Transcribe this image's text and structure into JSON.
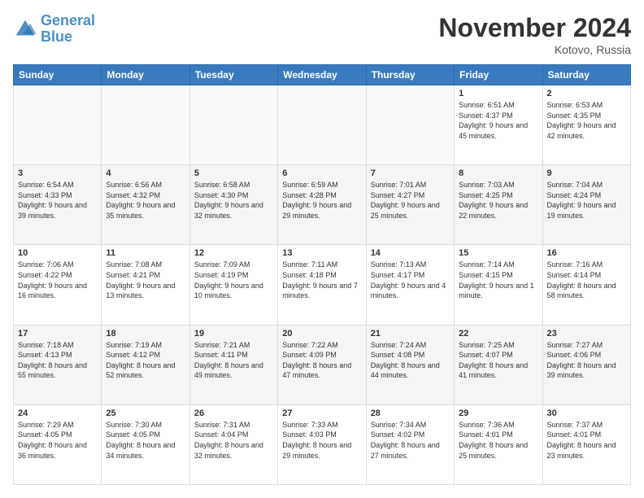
{
  "header": {
    "logo_line1": "General",
    "logo_line2": "Blue",
    "month": "November 2024",
    "location": "Kotovo, Russia"
  },
  "days_of_week": [
    "Sunday",
    "Monday",
    "Tuesday",
    "Wednesday",
    "Thursday",
    "Friday",
    "Saturday"
  ],
  "weeks": [
    [
      {
        "day": "",
        "sunrise": "",
        "sunset": "",
        "daylight": ""
      },
      {
        "day": "",
        "sunrise": "",
        "sunset": "",
        "daylight": ""
      },
      {
        "day": "",
        "sunrise": "",
        "sunset": "",
        "daylight": ""
      },
      {
        "day": "",
        "sunrise": "",
        "sunset": "",
        "daylight": ""
      },
      {
        "day": "",
        "sunrise": "",
        "sunset": "",
        "daylight": ""
      },
      {
        "day": "1",
        "sunrise": "Sunrise: 6:51 AM",
        "sunset": "Sunset: 4:37 PM",
        "daylight": "Daylight: 9 hours and 45 minutes."
      },
      {
        "day": "2",
        "sunrise": "Sunrise: 6:53 AM",
        "sunset": "Sunset: 4:35 PM",
        "daylight": "Daylight: 9 hours and 42 minutes."
      }
    ],
    [
      {
        "day": "3",
        "sunrise": "Sunrise: 6:54 AM",
        "sunset": "Sunset: 4:33 PM",
        "daylight": "Daylight: 9 hours and 39 minutes."
      },
      {
        "day": "4",
        "sunrise": "Sunrise: 6:56 AM",
        "sunset": "Sunset: 4:32 PM",
        "daylight": "Daylight: 9 hours and 35 minutes."
      },
      {
        "day": "5",
        "sunrise": "Sunrise: 6:58 AM",
        "sunset": "Sunset: 4:30 PM",
        "daylight": "Daylight: 9 hours and 32 minutes."
      },
      {
        "day": "6",
        "sunrise": "Sunrise: 6:59 AM",
        "sunset": "Sunset: 4:28 PM",
        "daylight": "Daylight: 9 hours and 29 minutes."
      },
      {
        "day": "7",
        "sunrise": "Sunrise: 7:01 AM",
        "sunset": "Sunset: 4:27 PM",
        "daylight": "Daylight: 9 hours and 25 minutes."
      },
      {
        "day": "8",
        "sunrise": "Sunrise: 7:03 AM",
        "sunset": "Sunset: 4:25 PM",
        "daylight": "Daylight: 9 hours and 22 minutes."
      },
      {
        "day": "9",
        "sunrise": "Sunrise: 7:04 AM",
        "sunset": "Sunset: 4:24 PM",
        "daylight": "Daylight: 9 hours and 19 minutes."
      }
    ],
    [
      {
        "day": "10",
        "sunrise": "Sunrise: 7:06 AM",
        "sunset": "Sunset: 4:22 PM",
        "daylight": "Daylight: 9 hours and 16 minutes."
      },
      {
        "day": "11",
        "sunrise": "Sunrise: 7:08 AM",
        "sunset": "Sunset: 4:21 PM",
        "daylight": "Daylight: 9 hours and 13 minutes."
      },
      {
        "day": "12",
        "sunrise": "Sunrise: 7:09 AM",
        "sunset": "Sunset: 4:19 PM",
        "daylight": "Daylight: 9 hours and 10 minutes."
      },
      {
        "day": "13",
        "sunrise": "Sunrise: 7:11 AM",
        "sunset": "Sunset: 4:18 PM",
        "daylight": "Daylight: 9 hours and 7 minutes."
      },
      {
        "day": "14",
        "sunrise": "Sunrise: 7:13 AM",
        "sunset": "Sunset: 4:17 PM",
        "daylight": "Daylight: 9 hours and 4 minutes."
      },
      {
        "day": "15",
        "sunrise": "Sunrise: 7:14 AM",
        "sunset": "Sunset: 4:15 PM",
        "daylight": "Daylight: 9 hours and 1 minute."
      },
      {
        "day": "16",
        "sunrise": "Sunrise: 7:16 AM",
        "sunset": "Sunset: 4:14 PM",
        "daylight": "Daylight: 8 hours and 58 minutes."
      }
    ],
    [
      {
        "day": "17",
        "sunrise": "Sunrise: 7:18 AM",
        "sunset": "Sunset: 4:13 PM",
        "daylight": "Daylight: 8 hours and 55 minutes."
      },
      {
        "day": "18",
        "sunrise": "Sunrise: 7:19 AM",
        "sunset": "Sunset: 4:12 PM",
        "daylight": "Daylight: 8 hours and 52 minutes."
      },
      {
        "day": "19",
        "sunrise": "Sunrise: 7:21 AM",
        "sunset": "Sunset: 4:11 PM",
        "daylight": "Daylight: 8 hours and 49 minutes."
      },
      {
        "day": "20",
        "sunrise": "Sunrise: 7:22 AM",
        "sunset": "Sunset: 4:09 PM",
        "daylight": "Daylight: 8 hours and 47 minutes."
      },
      {
        "day": "21",
        "sunrise": "Sunrise: 7:24 AM",
        "sunset": "Sunset: 4:08 PM",
        "daylight": "Daylight: 8 hours and 44 minutes."
      },
      {
        "day": "22",
        "sunrise": "Sunrise: 7:25 AM",
        "sunset": "Sunset: 4:07 PM",
        "daylight": "Daylight: 8 hours and 41 minutes."
      },
      {
        "day": "23",
        "sunrise": "Sunrise: 7:27 AM",
        "sunset": "Sunset: 4:06 PM",
        "daylight": "Daylight: 8 hours and 39 minutes."
      }
    ],
    [
      {
        "day": "24",
        "sunrise": "Sunrise: 7:29 AM",
        "sunset": "Sunset: 4:05 PM",
        "daylight": "Daylight: 8 hours and 36 minutes."
      },
      {
        "day": "25",
        "sunrise": "Sunrise: 7:30 AM",
        "sunset": "Sunset: 4:05 PM",
        "daylight": "Daylight: 8 hours and 34 minutes."
      },
      {
        "day": "26",
        "sunrise": "Sunrise: 7:31 AM",
        "sunset": "Sunset: 4:04 PM",
        "daylight": "Daylight: 8 hours and 32 minutes."
      },
      {
        "day": "27",
        "sunrise": "Sunrise: 7:33 AM",
        "sunset": "Sunset: 4:03 PM",
        "daylight": "Daylight: 8 hours and 29 minutes."
      },
      {
        "day": "28",
        "sunrise": "Sunrise: 7:34 AM",
        "sunset": "Sunset: 4:02 PM",
        "daylight": "Daylight: 8 hours and 27 minutes."
      },
      {
        "day": "29",
        "sunrise": "Sunrise: 7:36 AM",
        "sunset": "Sunset: 4:01 PM",
        "daylight": "Daylight: 8 hours and 25 minutes."
      },
      {
        "day": "30",
        "sunrise": "Sunrise: 7:37 AM",
        "sunset": "Sunset: 4:01 PM",
        "daylight": "Daylight: 8 hours and 23 minutes."
      }
    ]
  ]
}
